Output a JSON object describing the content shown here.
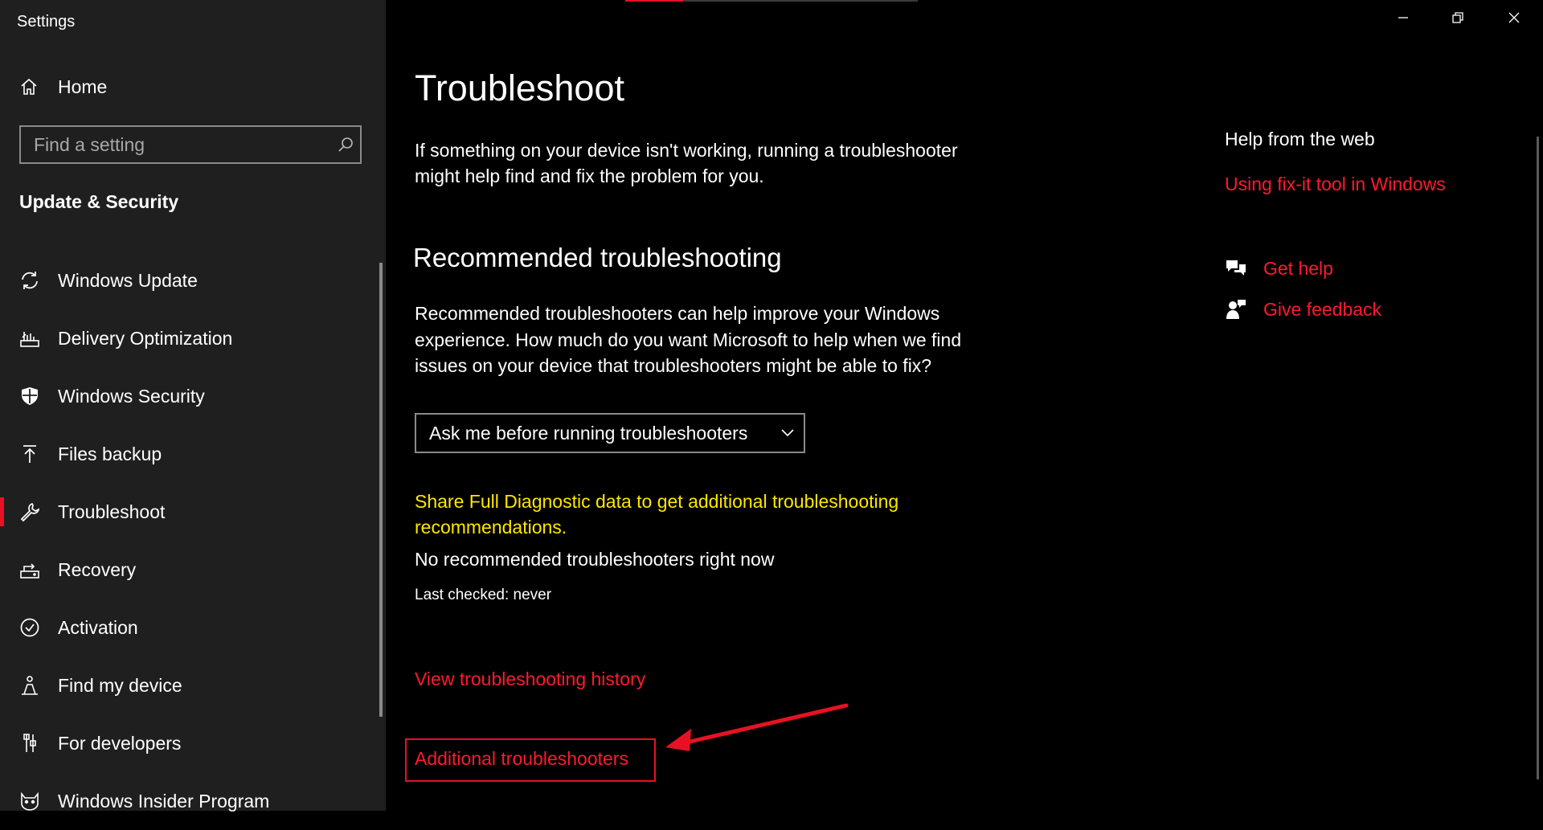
{
  "window": {
    "title": "Settings",
    "controls": [
      "minimize-icon",
      "restore-icon",
      "close-icon"
    ]
  },
  "sidebar": {
    "home_label": "Home",
    "search_placeholder": "Find a setting",
    "section_title": "Update & Security",
    "items": [
      {
        "label": "Windows Update",
        "icon": "sync-icon",
        "selected": false
      },
      {
        "label": "Delivery Optimization",
        "icon": "delivery-icon",
        "selected": false
      },
      {
        "label": "Windows Security",
        "icon": "shield-icon",
        "selected": false
      },
      {
        "label": "Files backup",
        "icon": "upload-icon",
        "selected": false
      },
      {
        "label": "Troubleshoot",
        "icon": "wrench-icon",
        "selected": true
      },
      {
        "label": "Recovery",
        "icon": "recovery-icon",
        "selected": false
      },
      {
        "label": "Activation",
        "icon": "check-circle-icon",
        "selected": false
      },
      {
        "label": "Find my device",
        "icon": "person-location-icon",
        "selected": false
      },
      {
        "label": "For developers",
        "icon": "developer-tools-icon",
        "selected": false
      },
      {
        "label": "Windows Insider Program",
        "icon": "insider-cat-icon",
        "selected": false
      }
    ]
  },
  "main": {
    "title": "Troubleshoot",
    "description": "If something on your device isn't working, running a troubleshooter might help find and fix the problem for you.",
    "recommended": {
      "heading": "Recommended troubleshooting",
      "description": "Recommended troubleshooters can help improve your Windows experience. How much do you want Microsoft to help when we find issues on your device that troubleshooters might be able to fix?",
      "dropdown_value": "Ask me before running troubleshooters",
      "diagnostic_link": "Share Full Diagnostic data to get additional troubleshooting recommendations.",
      "status": "No recommended troubleshooters right now",
      "last_checked": "Last checked: never"
    },
    "history_link": "View troubleshooting history",
    "additional_link": "Additional troubleshooters"
  },
  "help": {
    "heading": "Help from the web",
    "web_link": "Using fix-it tool in Windows",
    "get_help": "Get help",
    "give_feedback": "Give feedback"
  },
  "colors": {
    "accent": "#e81123",
    "link": "#ff1a2e",
    "diagnostic_link": "#ffe600",
    "sidebar_bg": "#1f1f1f",
    "main_bg": "#000000"
  }
}
